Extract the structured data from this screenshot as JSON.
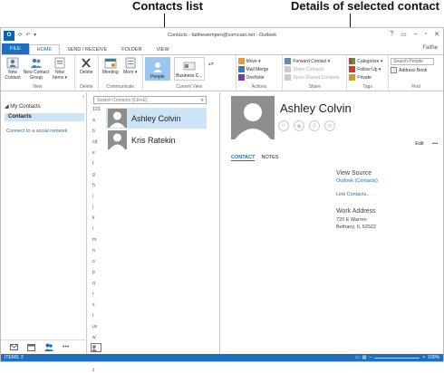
{
  "callouts": {
    "contacts_list": "Contacts list",
    "details": "Details of selected contact"
  },
  "window": {
    "title": "Contacts - faithewempen@comcast.net - Outlook",
    "controls": [
      "?",
      "▭",
      "–",
      "▫",
      "✕"
    ]
  },
  "tabs": {
    "file": "FILE",
    "home": "HOME",
    "send_receive": "SEND / RECEIVE",
    "folder": "FOLDER",
    "view": "VIEW"
  },
  "user": "Faithe",
  "ribbon": {
    "new": {
      "new_contact": "New Contact",
      "new_contact_group": "New Contact Group",
      "new_items": "New Items ▾",
      "label": "New"
    },
    "delete": {
      "delete": "Delete",
      "label": "Delete"
    },
    "communicate": {
      "meeting": "Meeting",
      "more": "More ▾",
      "label": "Communicate"
    },
    "current_view": {
      "people": "People",
      "business_card": "Business C...",
      "label": "Current View"
    },
    "actions": {
      "move": "Move ▾",
      "mail_merge": "Mail Merge",
      "onenote": "OneNote",
      "label": "Actions"
    },
    "share": {
      "forward_contact": "Forward Contact ▾",
      "share_contacts": "Share Contacts",
      "open_shared": "Open Shared Contacts",
      "label": "Share"
    },
    "tags": {
      "categorize": "Categorize ▾",
      "follow_up": "Follow Up ▾",
      "private": "Private",
      "label": "Tags"
    },
    "find": {
      "search_people": "Search People",
      "address_book": "Address Book",
      "label": "Find"
    }
  },
  "nav": {
    "header": "◢ My Contacts",
    "selected": "Contacts",
    "connect_link": "Connect to a social network",
    "bottom_icons": [
      "mail-icon",
      "calendar-icon",
      "people-icon",
      "more-icon"
    ],
    "more": "•••"
  },
  "list": {
    "search_placeholder": "Search Contacts (Ctrl+E)",
    "alphabet": [
      "123",
      "a",
      "b",
      "cd",
      "e",
      "f",
      "g",
      "h",
      "i",
      "j",
      "k",
      "l",
      "m",
      "n",
      "o",
      "p",
      "q",
      "r",
      "s",
      "t",
      "uv",
      "w",
      "x",
      "y",
      "z"
    ],
    "contacts": [
      {
        "name": "Ashley Colvin",
        "selected": true
      },
      {
        "name": "Kris Ratekin",
        "selected": false
      }
    ]
  },
  "detail": {
    "name": "Ashley Colvin",
    "edit": "Edit",
    "more": "•••",
    "tabs": {
      "contact": "CONTACT",
      "notes": "NOTES"
    },
    "view_source": "View Source",
    "source_link": "Outlook (Contacts)",
    "link_contacts": "Link Contacts...",
    "work_address_label": "Work Address",
    "address_line1": "720 E Warren",
    "address_line2": "Bethany, IL 62522"
  },
  "status": {
    "items": "ITEMS: 2",
    "zoom": "100%"
  },
  "colors": {
    "accent": "#1f6fbf",
    "selection": "#cde3f7",
    "link": "#1a6fc3"
  }
}
